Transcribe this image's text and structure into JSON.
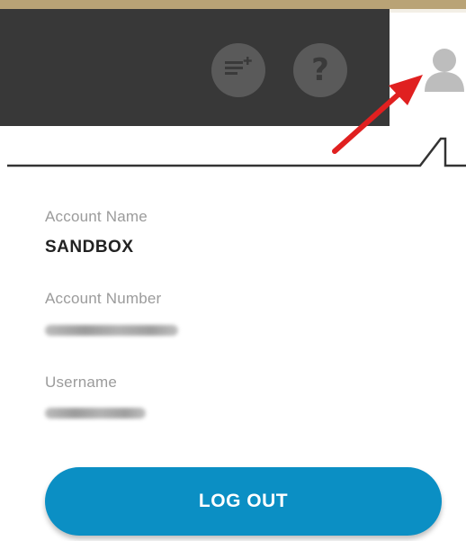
{
  "header": {
    "notes_icon": "notes-list-icon",
    "help_icon": "help-icon",
    "help_glyph": "?",
    "user_icon": "user-profile-icon"
  },
  "account": {
    "name_label": "Account Name",
    "name_value": "SANDBOX",
    "number_label": "Account Number",
    "username_label": "Username"
  },
  "actions": {
    "logout_label": "LOG OUT"
  },
  "colors": {
    "accent_gold": "#b9a376",
    "header_dark": "#383838",
    "button_blue": "#0b8fc4",
    "annotation_red": "#e02020"
  }
}
